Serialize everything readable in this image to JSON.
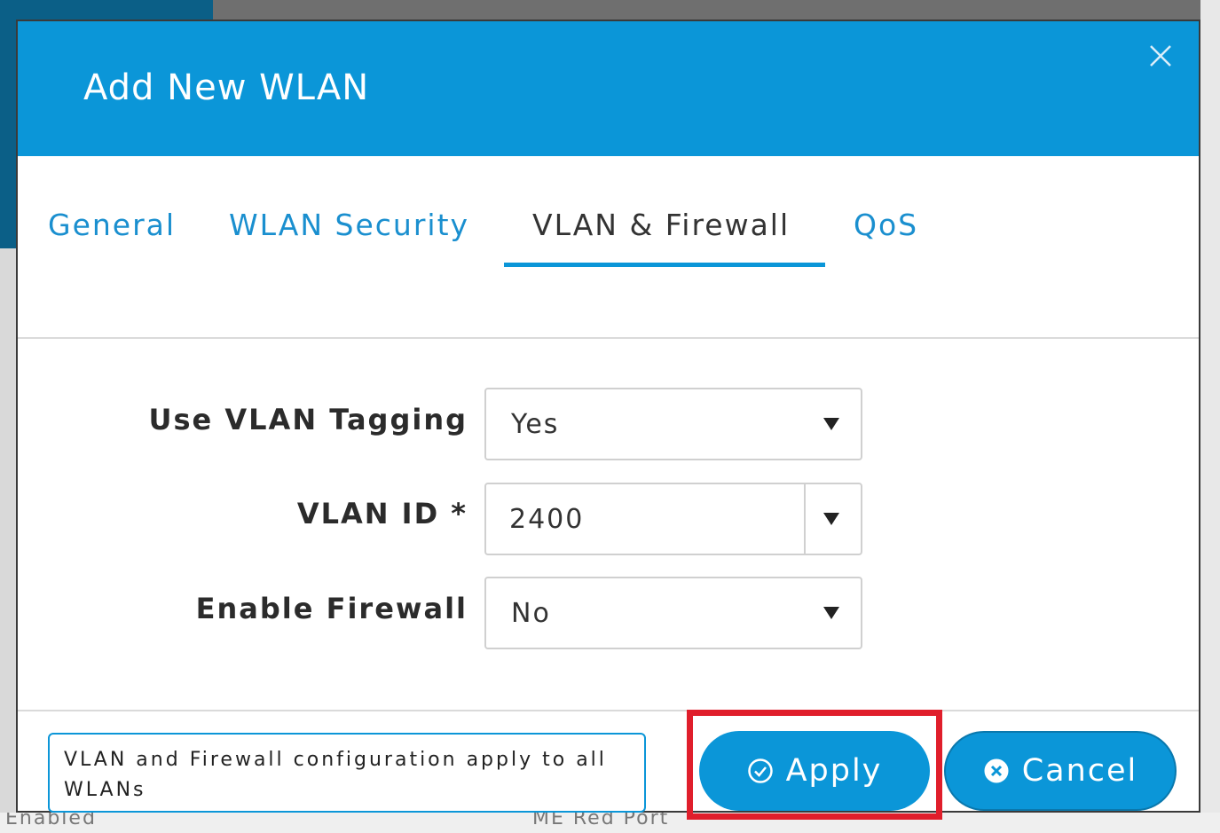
{
  "modal": {
    "title": "Add New WLAN",
    "close_icon": "close-icon"
  },
  "tabs": [
    {
      "label": "General",
      "active": false
    },
    {
      "label": "WLAN Security",
      "active": false
    },
    {
      "label": "VLAN & Firewall",
      "active": true
    },
    {
      "label": "QoS",
      "active": false
    }
  ],
  "form": {
    "use_vlan_tagging": {
      "label": "Use VLAN Tagging",
      "value": "Yes"
    },
    "vlan_id": {
      "label": "VLAN ID *",
      "value": "2400"
    },
    "enable_firewall": {
      "label": "Enable Firewall",
      "value": "No"
    }
  },
  "footer": {
    "note": "VLAN and Firewall configuration apply to all WLANs",
    "apply_label": "Apply",
    "apply_icon": "check-circle-icon",
    "cancel_label": "Cancel",
    "cancel_icon": "x-circle-icon"
  },
  "background": {
    "bottom_text_left": "Enabled",
    "bottom_text_mid": "ME Red Port"
  },
  "colors": {
    "header": "#0b96d8",
    "accent": "#0b96d8",
    "highlight": "#e01e2b"
  }
}
